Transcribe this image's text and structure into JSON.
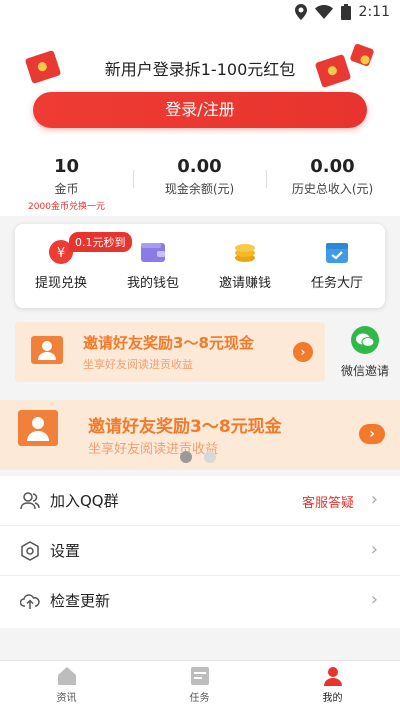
{
  "status_bar": {
    "time": "2:11"
  },
  "promo": {
    "title": "新用户登录拆1-100元红包",
    "login_button": "登录/注册"
  },
  "stats": [
    {
      "value": "10",
      "label": "金币",
      "hint": "2000金币兑换一元"
    },
    {
      "value": "0.00",
      "label": "现金余额(元)"
    },
    {
      "value": "0.00",
      "label": "历史总收入(元)"
    }
  ],
  "functions": {
    "badge": "0.1元秒到",
    "items": [
      {
        "label": "提现兑换",
        "icon": "yuan-coin-icon"
      },
      {
        "label": "我的钱包",
        "icon": "wallet-icon"
      },
      {
        "label": "邀请赚钱",
        "icon": "coin-stack-icon"
      },
      {
        "label": "任务大厅",
        "icon": "calendar-check-icon"
      }
    ]
  },
  "invite": {
    "title": "邀请好友奖励3～8元现金",
    "subtitle": "坐享好友阅读进贡收益",
    "wechat_label": "微信邀请"
  },
  "carousel": {
    "title": "邀请好友奖励3～8元现金",
    "subtitle": "坐享好友阅读进贡收益",
    "page_count": 2,
    "active_index": 0
  },
  "menu": [
    {
      "label": "加入QQ群",
      "right_text": "客服答疑",
      "icon": "users-icon"
    },
    {
      "label": "设置",
      "icon": "settings-hex-icon"
    },
    {
      "label": "检查更新",
      "icon": "cloud-upload-icon"
    }
  ],
  "tabs": [
    {
      "label": "资讯",
      "icon": "home-icon"
    },
    {
      "label": "任务",
      "icon": "task-icon"
    },
    {
      "label": "我的",
      "icon": "profile-icon",
      "active": true
    }
  ],
  "colors": {
    "brand_red": "#e8342e",
    "accent_orange": "#f37a2a",
    "banner_bg": "#fde9d8"
  }
}
